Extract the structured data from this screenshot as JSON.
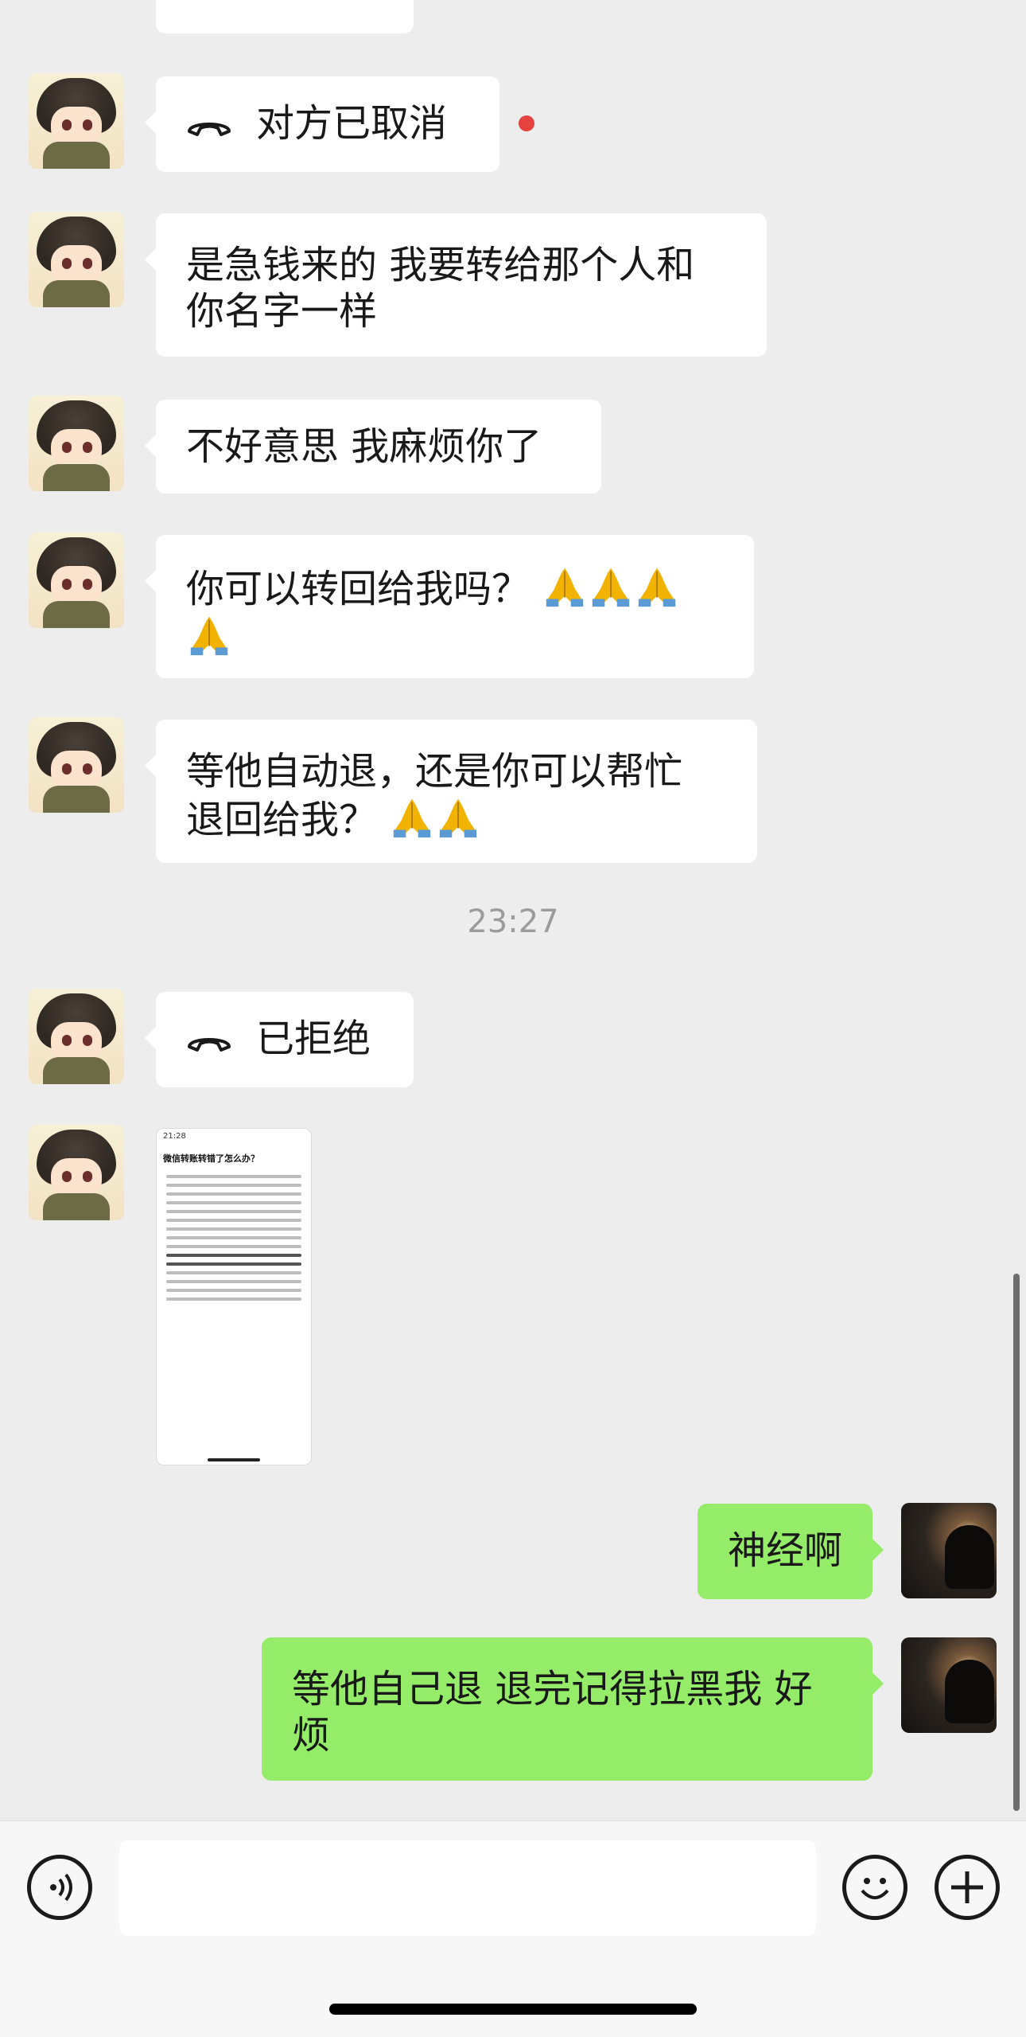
{
  "chat": {
    "messages": [
      {
        "side": "left",
        "kind": "call",
        "text": "对方已取消",
        "icon": "phone-hangup-icon",
        "unread_dot": true
      },
      {
        "side": "left",
        "kind": "text",
        "lines": [
          "是急钱来的 我要转给那个人和",
          "你名字一样"
        ]
      },
      {
        "side": "left",
        "kind": "text",
        "lines": [
          "不好意思 我麻烦你了"
        ]
      },
      {
        "side": "left",
        "kind": "text",
        "lines": [
          "你可以转回给我吗？"
        ],
        "emoji": "folded-hands-emoji"
      },
      {
        "side": "left",
        "kind": "text",
        "lines": [
          "等他自动退，还是你可以帮忙",
          "退回给我？"
        ],
        "emoji": "folded-hands-emoji"
      },
      {
        "side": "left",
        "kind": "call",
        "text": "已拒绝",
        "icon": "phone-hangup-icon"
      },
      {
        "side": "left",
        "kind": "image",
        "thumbnail": {
          "status_time": "21:28",
          "title": "微信转账转错了怎么办？"
        }
      },
      {
        "side": "right",
        "kind": "text",
        "lines": [
          "神经啊"
        ]
      },
      {
        "side": "right",
        "kind": "text",
        "lines": [
          "等他自己退 退完记得拉黑我 好",
          "烦"
        ]
      }
    ],
    "timestamp": "23:27"
  },
  "colors": {
    "bg": "#ededed",
    "bubble_in": "#ffffff",
    "bubble_out": "#95ec69",
    "unread": "#e64340"
  },
  "input_bar": {
    "voice_icon": "voice-input-icon",
    "emoji_icon": "emoji-icon",
    "plus_icon": "plus-icon"
  }
}
